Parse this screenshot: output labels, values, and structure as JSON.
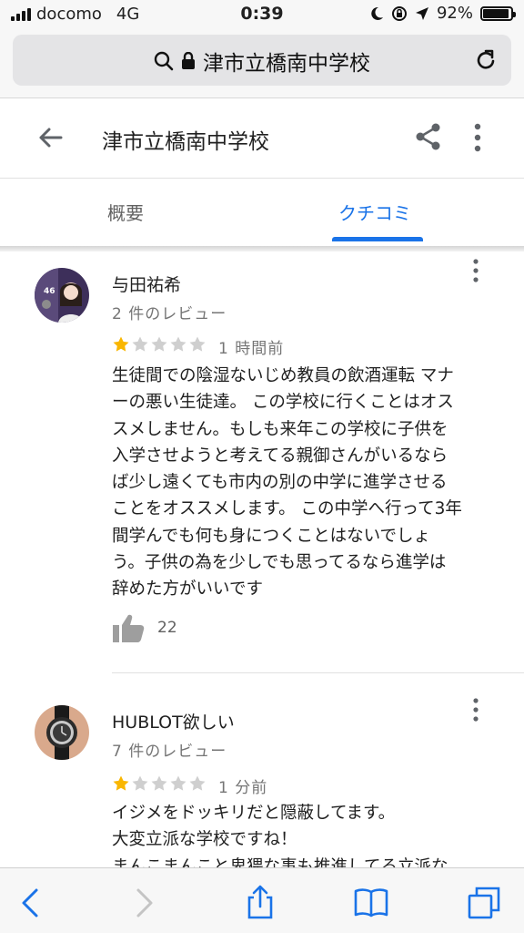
{
  "status_bar": {
    "carrier": "docomo",
    "network": "4G",
    "time": "0:39",
    "battery": "92%",
    "battery_level": 0.92
  },
  "browser": {
    "url_text": "津市立橋南中学校"
  },
  "header": {
    "title": "津市立橋南中学校"
  },
  "tabs": [
    {
      "label": "概要",
      "active": false
    },
    {
      "label": "クチコミ",
      "active": true
    }
  ],
  "colors": {
    "accent": "#1a73e8",
    "star_filled": "#f9b600",
    "star_empty": "#cfcfcf"
  },
  "reviews": [
    {
      "name": "与田祐希",
      "review_count": "2 件のレビュー",
      "rating": 1,
      "time": "1 時間前",
      "text": "生徒間での陰湿ないじめ教員の飲酒運転 マナ\nーの悪い生徒達。 この学校に行くことはオス\nスメしません。もしも来年この学校に子供を\n入学させようと考えてる親御さんがいるなら\nば少し遠くても市内の別の中学に進学させる\nことをオススメします。 この中学へ行って3年\n間学んでも何も身につくことはないでしょ\nう。子供の為を少しでも思ってるなら進学は\n辞めた方がいいです",
      "likes": "22",
      "avatar_badge": "46"
    },
    {
      "name": "HUBLOT欲しい",
      "review_count": "7 件のレビュー",
      "rating": 1,
      "time": "1 分前",
      "text": "イジメをドッキリだと隠蔽してます。\n大変立派な学校ですね！\nまんこまんこと卑猥な事も推進してる立派な"
    }
  ]
}
